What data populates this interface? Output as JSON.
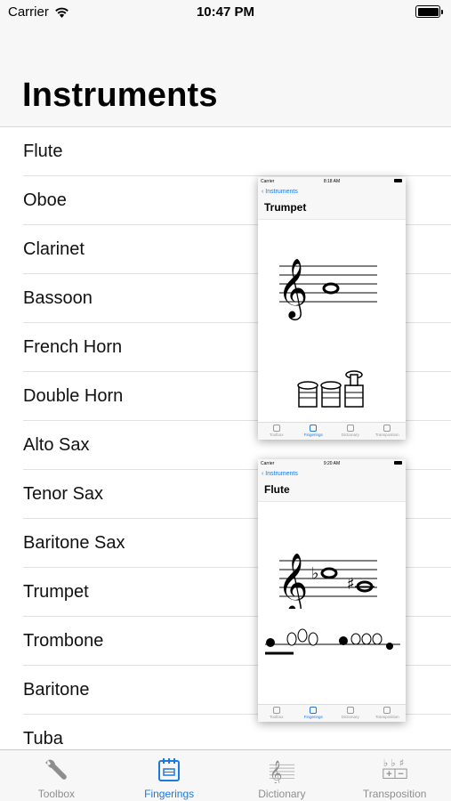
{
  "status_bar": {
    "carrier": "Carrier",
    "time": "10:47 PM"
  },
  "nav": {
    "title": "Instruments"
  },
  "instruments": [
    "Flute",
    "Oboe",
    "Clarinet",
    "Bassoon",
    "French Horn",
    "Double Horn",
    "Alto Sax",
    "Tenor Sax",
    "Baritone Sax",
    "Trumpet",
    "Trombone",
    "Baritone",
    "Tuba"
  ],
  "previews": [
    {
      "status_carrier": "Carrier",
      "status_time": "8:18 AM",
      "back_label": "Instruments",
      "title": "Trumpet",
      "tabs": [
        "Toolbox",
        "Fingerings",
        "Dictionary",
        "Transposition"
      ]
    },
    {
      "status_carrier": "Carrier",
      "status_time": "9:20 AM",
      "back_label": "Instruments",
      "title": "Flute",
      "tabs": [
        "Toolbox",
        "Fingerings",
        "Dictionary",
        "Transposition"
      ]
    }
  ],
  "tab_bar": {
    "items": [
      {
        "label": "Toolbox",
        "icon": "wrench-icon"
      },
      {
        "label": "Fingerings",
        "icon": "fingering-chart-icon"
      },
      {
        "label": "Dictionary",
        "icon": "treble-clef-staff-icon"
      },
      {
        "label": "Transposition",
        "icon": "transposition-icon"
      }
    ],
    "active": "Fingerings"
  },
  "colors": {
    "accent": "#1a7ae0",
    "inactive": "#8e8e8e",
    "bar_bg": "#f7f7f7"
  }
}
